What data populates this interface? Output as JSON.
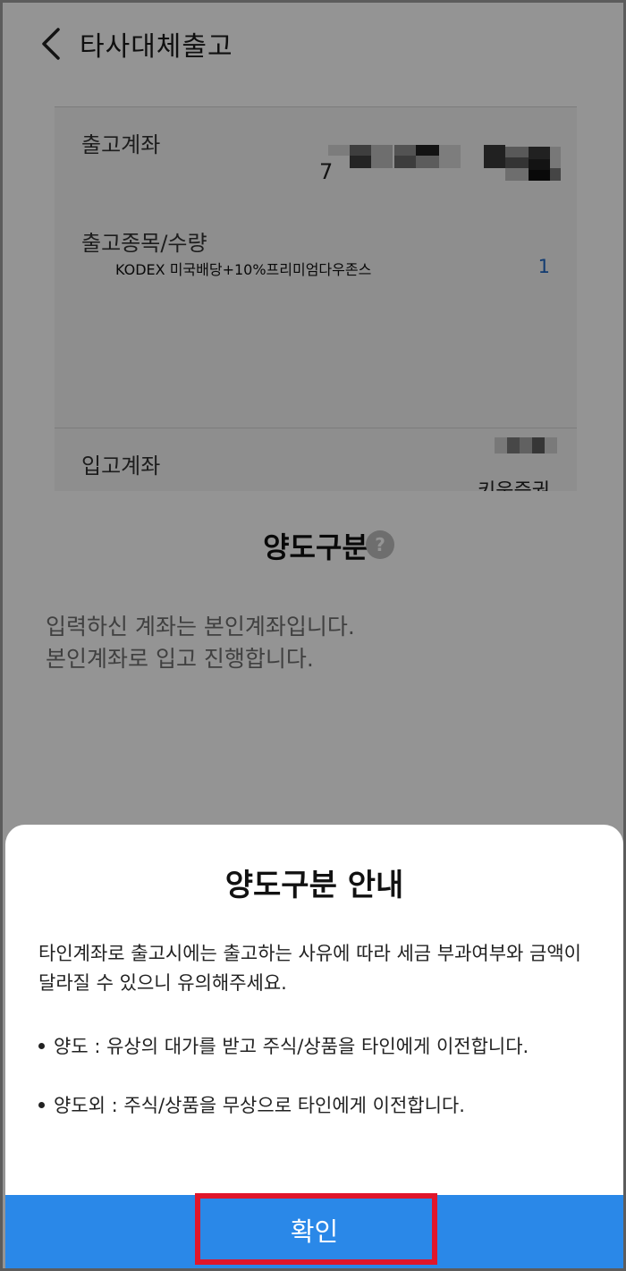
{
  "header": {
    "title": "타사대체출고",
    "back_icon": "chevron-left-icon"
  },
  "transfer": {
    "withdraw_account_label": "출고계좌",
    "withdraw_account_visible": "7",
    "item_label": "출고종목/수량",
    "item_name": "KODEX 미국배당+10%프리미엄다우존스",
    "item_quantity": "1",
    "deposit_account_label": "입고계좌",
    "deposit_broker_partial": "키움증권"
  },
  "transfer_type_panel": {
    "title": "양도구분",
    "help_icon": "question-circle-icon",
    "help_glyph": "?",
    "line1": "입력하신 계좌는 본인계좌입니다.",
    "line2": "본인계좌로 입고 진행합니다."
  },
  "modal": {
    "title": "양도구분 안내",
    "description": "타인계좌로 출고시에는 출고하는 사유에 따라 세금 부과여부와 금액이 달라질 수 있으니 유의해주세요.",
    "bullets": [
      "양도 : 유상의 대가를 받고 주식/상품을 타인에게 이전합니다.",
      "양도외 : 주식/상품을 무상으로 타인에게 이전합니다."
    ],
    "confirm_label": "확인"
  },
  "colors": {
    "confirm_button": "#2a88e8",
    "highlight_box": "#e0162b",
    "quantity_text": "#1f67c3"
  }
}
